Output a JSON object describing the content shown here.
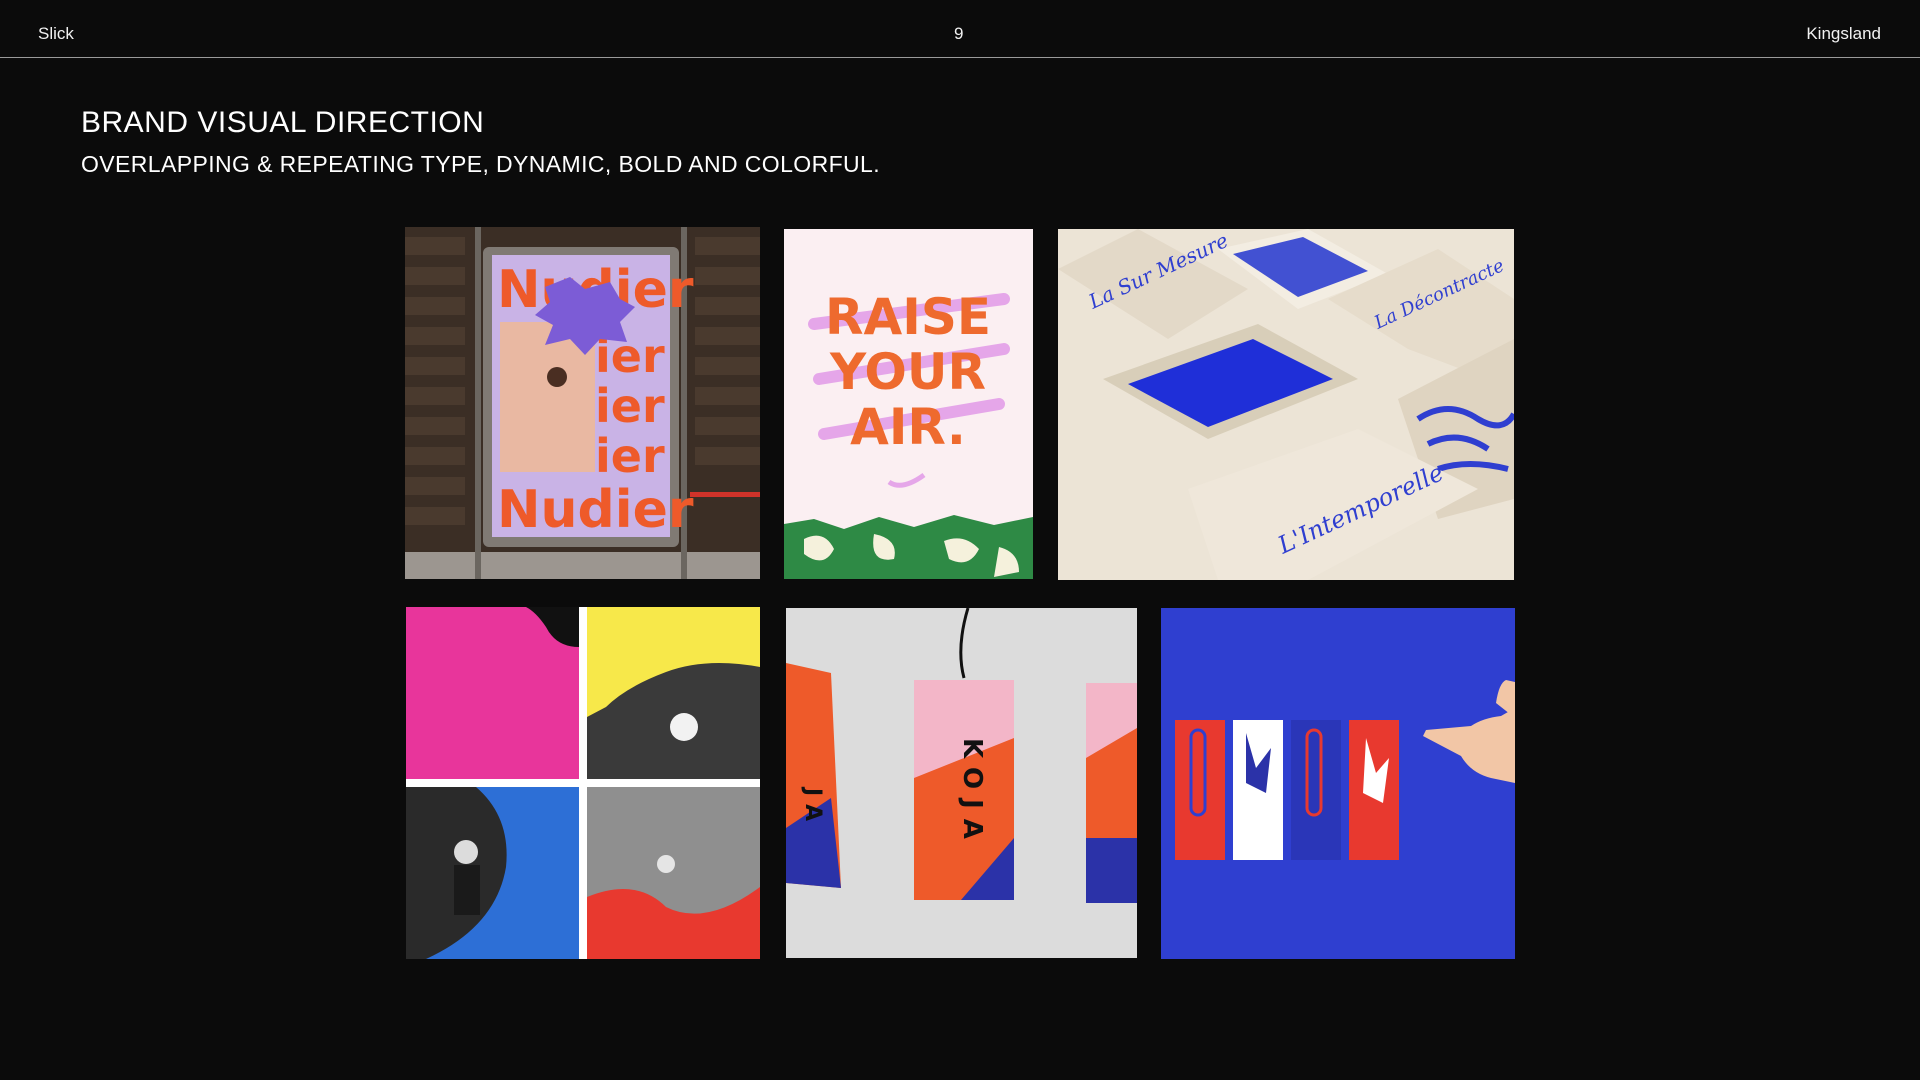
{
  "header": {
    "left": "Slick",
    "page_number": "9",
    "right": "Kingsland"
  },
  "slide": {
    "title": "BRAND VISUAL DIRECTION",
    "subtitle": "OVERLAPPING & REPEATING TYPE, DYNAMIC, BOLD AND COLORFUL."
  },
  "images": {
    "bus_stop_poster": {
      "big_word": "Nudier",
      "lines": [
        "ier",
        "ier",
        "ier"
      ]
    },
    "raise_your_air": {
      "line1": "RAISE",
      "line2": "YOUR",
      "line3": "AIR."
    },
    "boxes": {
      "script1": "La Sur Mesure",
      "script2": "La Décontracte",
      "script3": "L'Intemporelle"
    },
    "koja_tags": {
      "tag_main": "KOJA",
      "tag_left": "JA"
    },
    "blue_posters": {}
  },
  "colors": {
    "background": "#0b0b0b",
    "orange": "#ee5a2a",
    "lavender": "#c9b3e6",
    "pink": "#e8359b",
    "yellow": "#f7e84a",
    "blue": "#2d6fd6",
    "red": "#e8392f",
    "royal_blue": "#2f3fd0",
    "kraft": "#e6ddcd"
  }
}
